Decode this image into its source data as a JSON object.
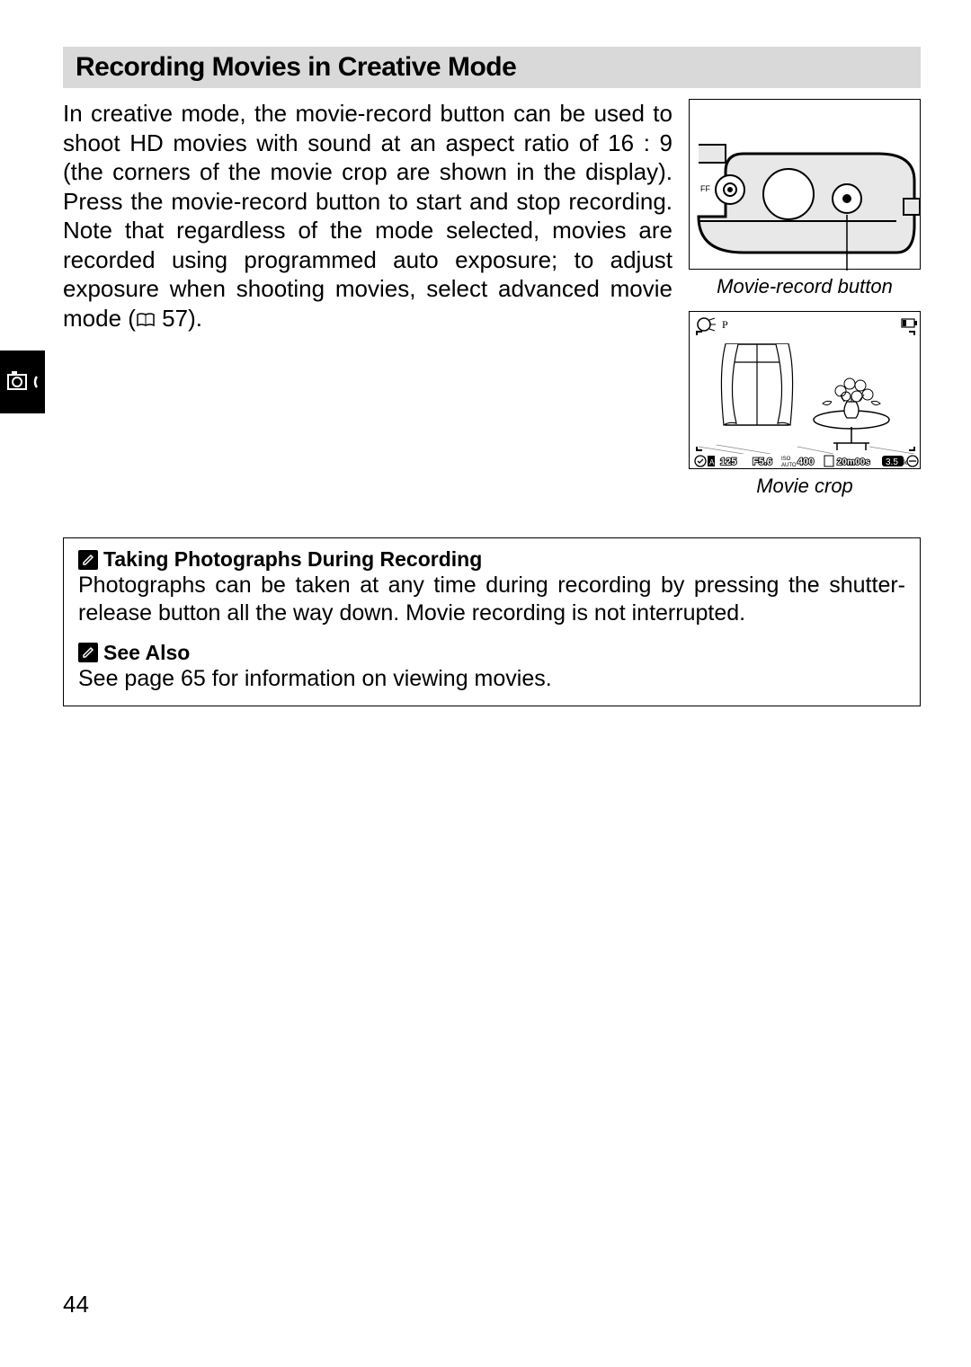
{
  "heading": "Recording Movies in Creative Mode",
  "body": {
    "p1a": "In creative mode, the movie-record button can be used to shoot HD movies with sound at an aspect ratio of 16 : 9 (the corners of the movie crop are shown in the display). Press the movie-record button to start and stop recording. Note that regardless of the mode selected, movies are recorded using programmed auto exposure; to adjust exposure when shooting movies, select advanced movie mode (",
    "p1_ref": "57",
    "p1b": ")."
  },
  "figures": {
    "fig1_caption": "Movie-record button",
    "fig2_caption": "Movie crop",
    "fig2_status": {
      "shutter": "125",
      "aperture": "F5.6",
      "iso": "400",
      "time": "20m00s",
      "k": "3.5"
    }
  },
  "info": {
    "title1": "Taking Photographs During Recording",
    "body1": "Photographs can be taken at any time during recording by pressing the shutter-release button all the way down. Movie recording is not interrupted.",
    "title2": "See Also",
    "body2": "See page 65 for information on viewing movies."
  },
  "page_number": "44"
}
